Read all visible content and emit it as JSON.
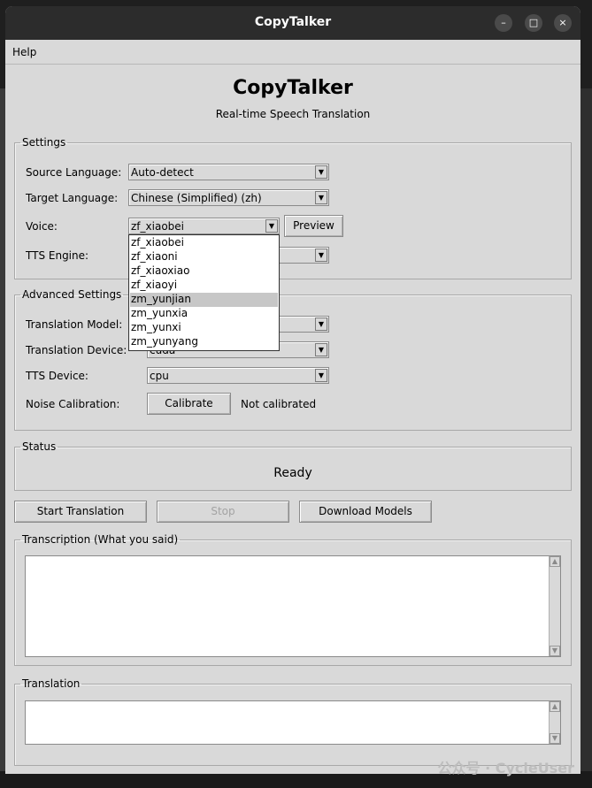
{
  "window": {
    "title": "CopyTalker",
    "controls": [
      "–",
      "□",
      "×"
    ]
  },
  "menu": {
    "help": "Help"
  },
  "header": {
    "title": "CopyTalker",
    "subtitle": "Real-time Speech Translation"
  },
  "settings": {
    "legend": "Settings",
    "source_language": {
      "label": "Source Language:",
      "value": "Auto-detect"
    },
    "target_language": {
      "label": "Target Language:",
      "value": "Chinese (Simplified) (zh)"
    },
    "voice": {
      "label": "Voice:",
      "value": "zf_xiaobei",
      "preview": "Preview"
    },
    "tts_engine": {
      "label": "TTS Engine:"
    }
  },
  "voice_dropdown": {
    "options": [
      "zf_xiaobei",
      "zf_xiaoni",
      "zf_xiaoxiao",
      "zf_xiaoyi",
      "zm_yunjian",
      "zm_yunxia",
      "zm_yunxi",
      "zm_yunyang"
    ],
    "highlighted": "zm_yunjian"
  },
  "advanced": {
    "legend": "Advanced Settings",
    "translation_model": {
      "label": "Translation Model:"
    },
    "translation_device": {
      "label": "Translation Device:",
      "value": "cuda"
    },
    "tts_device": {
      "label": "TTS Device:",
      "value": "cpu"
    },
    "noise": {
      "label": "Noise Calibration:",
      "button": "Calibrate",
      "status": "Not calibrated"
    }
  },
  "status": {
    "legend": "Status",
    "text": "Ready"
  },
  "actions": {
    "start": "Start Translation",
    "stop": "Stop",
    "download": "Download Models"
  },
  "transcription": {
    "legend": "Transcription (What you said)",
    "text": ""
  },
  "translation": {
    "legend": "Translation",
    "text": ""
  },
  "watermark": "公众号 · CycleUser",
  "icons": {
    "dropdown_arrow": "▼",
    "scroll_up": "▲",
    "scroll_down": "▼"
  }
}
